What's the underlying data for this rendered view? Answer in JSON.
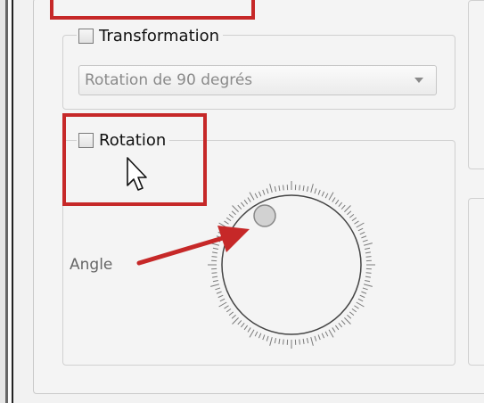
{
  "transformation": {
    "checkbox_label": "Transformation",
    "checked": false,
    "combo_value": "Rotation de 90 degrés"
  },
  "rotation": {
    "checkbox_label": "Rotation",
    "checked": false,
    "angle_label": "Angle"
  },
  "icons": {
    "cursor": "mouse-pointer-icon",
    "combo_arrow": "chevron-down-icon",
    "annotation_arrow": "red-arrow-icon"
  },
  "colors": {
    "annotation_red": "#c62828",
    "panel_background": "#f4f4f4",
    "disabled_text": "#8a8a8a"
  }
}
